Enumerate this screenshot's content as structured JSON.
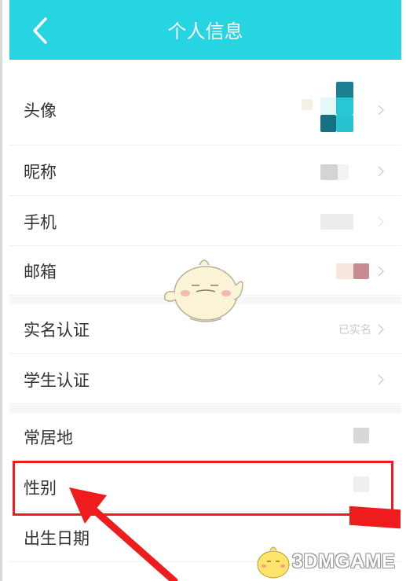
{
  "header": {
    "title": "个人信息"
  },
  "rows": [
    {
      "label": "头像"
    },
    {
      "label": "昵称"
    },
    {
      "label": "手机"
    },
    {
      "label": "邮箱"
    },
    {
      "label": "实名认证",
      "value": "已实名"
    },
    {
      "label": "学生认证"
    },
    {
      "label": "常居地"
    },
    {
      "label": "性别"
    },
    {
      "label": "出生日期"
    }
  ],
  "watermark": {
    "text": "3DMGAME"
  },
  "colors": {
    "header_bg": "#27d5e2",
    "highlight": "#ee1c1c"
  },
  "icons": {
    "back": "chevron-left-icon",
    "row_arrow": "chevron-right-icon"
  }
}
